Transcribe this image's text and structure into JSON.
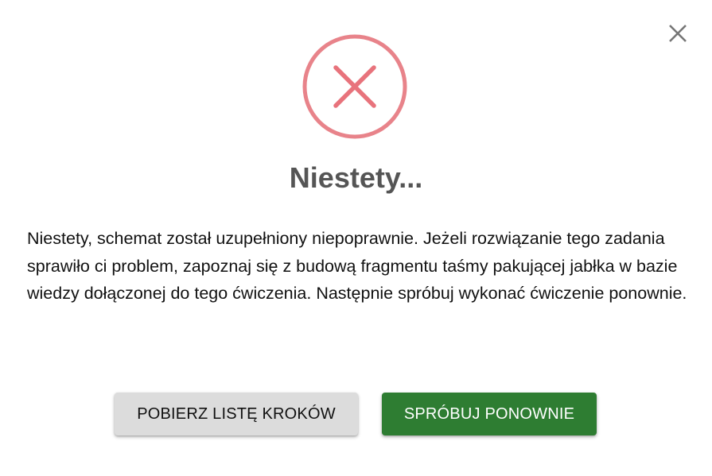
{
  "dialog": {
    "close_icon": "close-icon",
    "status_icon": "error-x-circle-icon",
    "title": "Niestety...",
    "message": "Niestety, schemat został uzupełniony niepoprawnie. Jeżeli rozwiązanie tego zadania sprawiło ci problem, zapoznaj się z budową fragmentu taśmy pakującej jabłka w bazie wiedzy dołączonej do tego ćwiczenia. Następnie spróbuj wykonać ćwiczenie ponownie.",
    "download_steps_label": "POBIERZ LISTĘ KROKÓW",
    "retry_label": "SPRÓBUJ PONOWNIE"
  },
  "colors": {
    "error_red": "#e57373",
    "primary_green": "#2e7d32",
    "secondary_gray": "#dcdcdc",
    "title_gray": "#555555",
    "close_gray": "#757575"
  }
}
